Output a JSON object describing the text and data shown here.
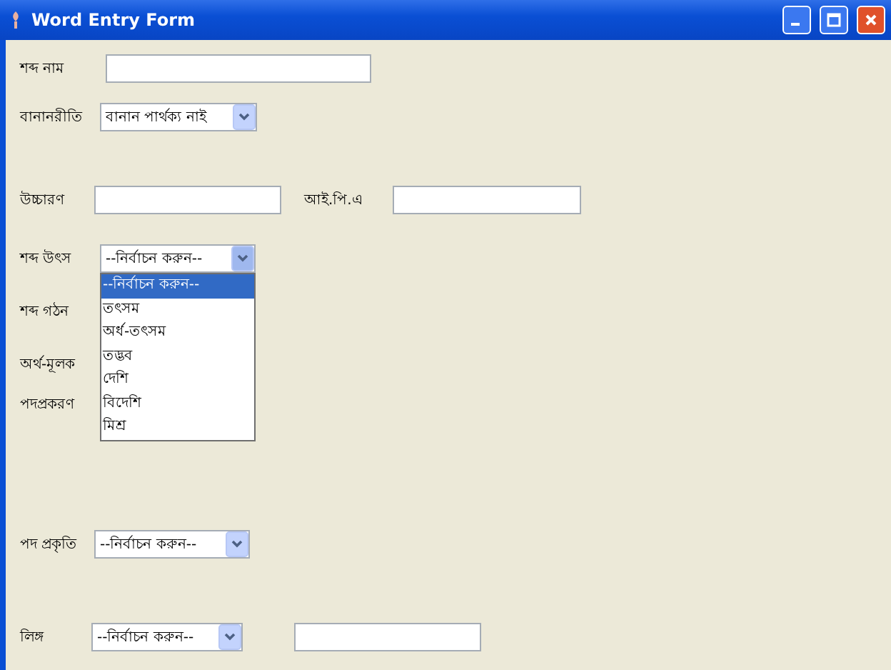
{
  "window": {
    "title": "Word Entry Form"
  },
  "rows": [
    {
      "fields": [
        {
          "kind": "text",
          "label": "শব্দ নাম"
        }
      ]
    },
    {
      "fields": [
        {
          "kind": "select",
          "label": "বানানরীতি",
          "value": "বানান পার্থক্য নাই",
          "expanded": false
        }
      ]
    },
    {
      "fields": [
        {
          "kind": "text",
          "label": "উচ্চারণ"
        },
        {
          "kind": "text",
          "label": "আই.পি.এ"
        }
      ]
    },
    {
      "fields": [
        {
          "kind": "select",
          "label": "শব্দ উৎস",
          "value": "--নির্বাচন করুন--",
          "expanded": true,
          "options": [
            {
              "label": "--নির্বাচন করুন--",
              "selected": true
            },
            {
              "label": "তৎসম",
              "selected": false
            },
            {
              "label": "অর্ধ-তৎসম",
              "selected": false
            },
            {
              "label": "তদ্ভব",
              "selected": false
            },
            {
              "label": "দেশি",
              "selected": false
            },
            {
              "label": "বিদেশি",
              "selected": false
            },
            {
              "label": "মিশ্র",
              "selected": false
            }
          ]
        }
      ]
    },
    {
      "fields": [
        {
          "kind": "label",
          "label": "শব্দ গঠন"
        }
      ]
    },
    {
      "fields": [
        {
          "kind": "label",
          "label": "অর্থ-মূলক"
        }
      ]
    },
    {
      "fields": [
        {
          "kind": "label",
          "label": "পদপ্রকরণ"
        }
      ]
    },
    {
      "fields": [
        {
          "kind": "select",
          "label": "পদ প্রকৃতি",
          "value": "--নির্বাচন করুন--",
          "expanded": false
        }
      ]
    },
    {
      "fields": [
        {
          "kind": "select",
          "label": "লিঙ্গ",
          "value": "--নির্বাচন করুন--",
          "expanded": false
        },
        {
          "kind": "text"
        }
      ]
    }
  ]
}
